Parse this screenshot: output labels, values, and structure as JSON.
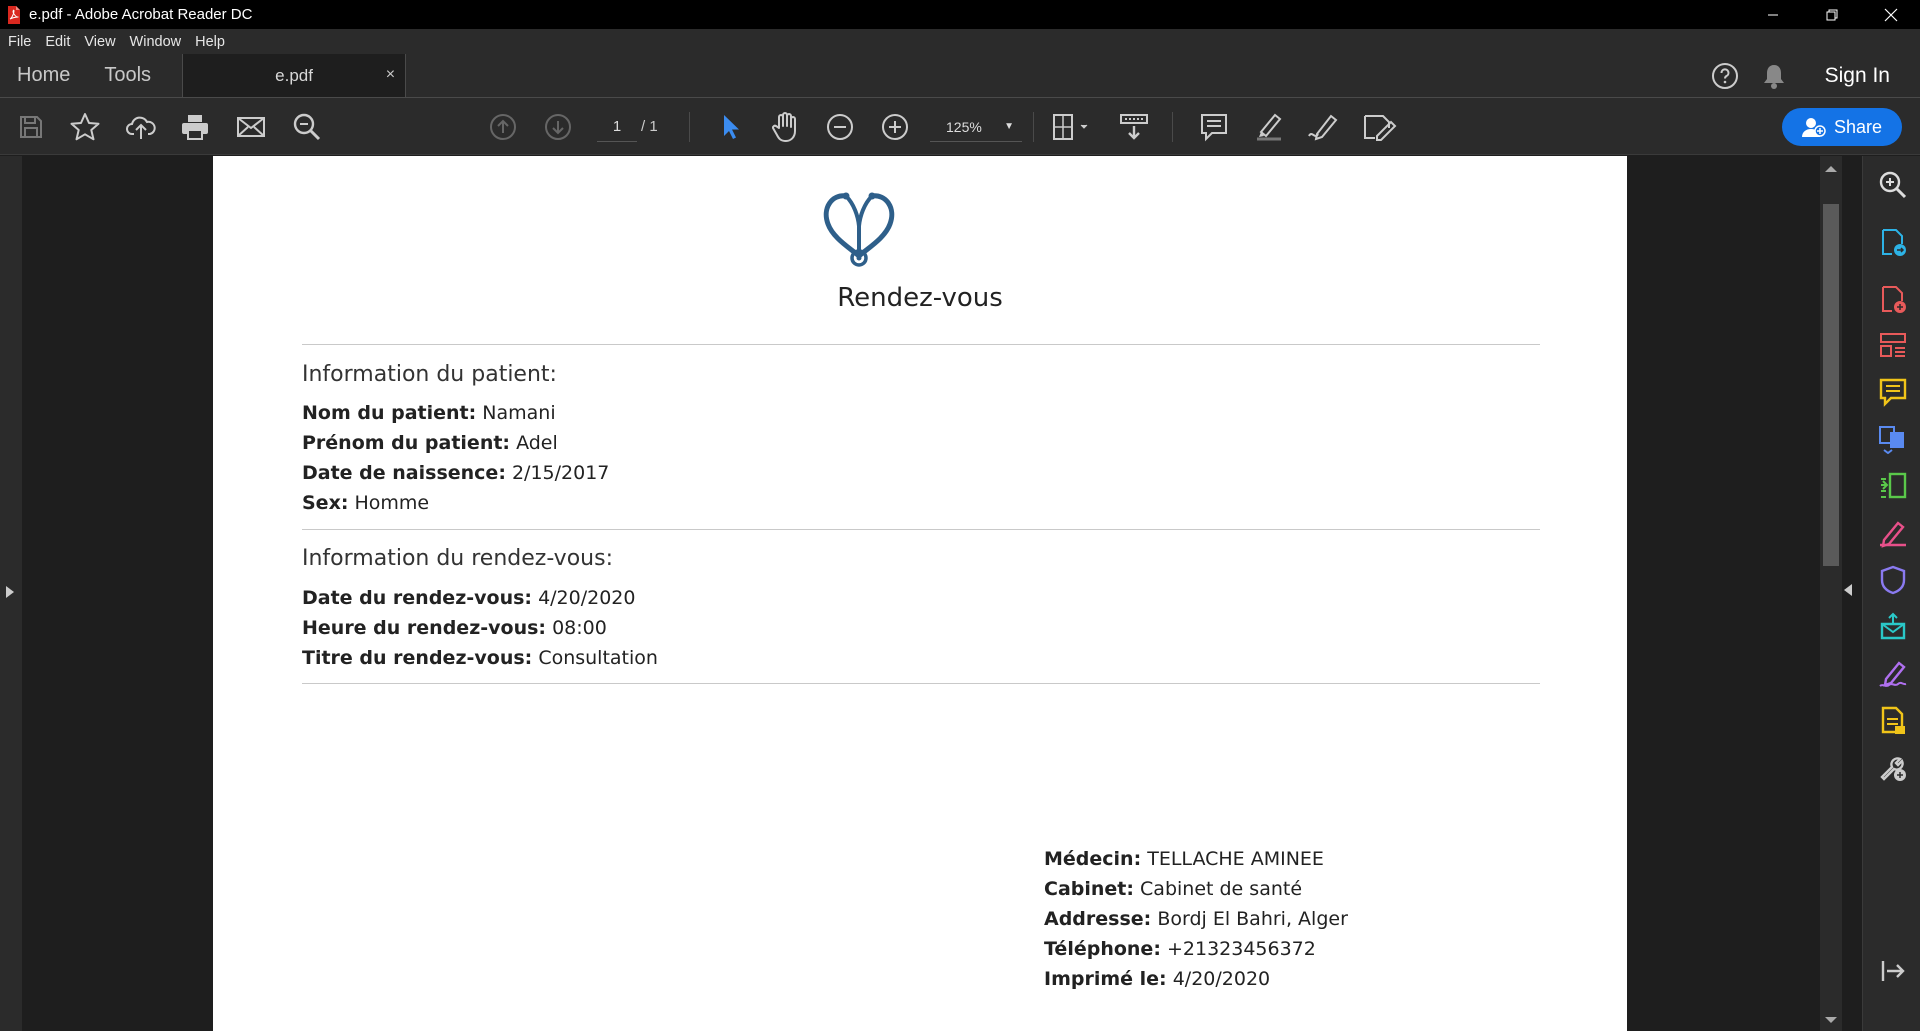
{
  "window": {
    "title": "e.pdf - Adobe Acrobat Reader DC"
  },
  "menu": [
    "File",
    "Edit",
    "View",
    "Window",
    "Help"
  ],
  "tabs": {
    "home": "Home",
    "tools": "Tools",
    "document": "e.pdf",
    "close_glyph": "×"
  },
  "header": {
    "sign_in": "Sign In",
    "share": "Share"
  },
  "toolbar": {
    "page_current": "1",
    "page_total": "/ 1",
    "zoom": "125%"
  },
  "document": {
    "title": "Rendez-vous",
    "patient_section": {
      "heading": "Information du patient:",
      "fields": [
        {
          "label": "Nom du patient:",
          "value": "Namani"
        },
        {
          "label": "Prénom du patient:",
          "value": "Adel"
        },
        {
          "label": "Date de naissence:",
          "value": "2/15/2017"
        },
        {
          "label": "Sex:",
          "value": "Homme"
        }
      ]
    },
    "appointment_section": {
      "heading": "Information du rendez-vous:",
      "fields": [
        {
          "label": "Date du rendez-vous:",
          "value": "4/20/2020"
        },
        {
          "label": "Heure du rendez-vous:",
          "value": "08:00"
        },
        {
          "label": "Titre du rendez-vous:",
          "value": "Consultation"
        }
      ]
    },
    "footer_fields": [
      {
        "label": "Médecin:",
        "value": "TELLACHE AMINEE"
      },
      {
        "label": "Cabinet:",
        "value": "Cabinet de santé"
      },
      {
        "label": "Addresse:",
        "value": "Bordj El Bahri, Alger"
      },
      {
        "label": "Téléphone:",
        "value": "+21323456372"
      },
      {
        "label": "Imprimé le:",
        "value": "4/20/2020"
      }
    ]
  },
  "icons": {
    "toolbar": [
      "save-icon",
      "star-icon",
      "upload-cloud-icon",
      "print-icon",
      "email-icon",
      "zoom-search-icon",
      "page-up-icon",
      "page-down-icon",
      "select-cursor-icon",
      "hand-icon",
      "zoom-out-icon",
      "zoom-in-icon",
      "page-fit-icon",
      "scroll-mode-icon",
      "comment-icon",
      "highlight-pen-icon",
      "draw-sign-icon",
      "fill-sign-icon"
    ],
    "right_panel": [
      "zoom-search-icon",
      "export-pdf-icon",
      "create-pdf-icon",
      "organize-pages-icon",
      "comment-icon",
      "combine-files-icon",
      "compress-icon",
      "fill-sign-icon",
      "protect-shield-icon",
      "send-review-icon",
      "request-signature-icon",
      "scan-icon",
      "more-tools-icon",
      "collapse-panel-icon"
    ]
  },
  "colors": {
    "accent": "#1473e6",
    "logo": "#2e5f8a",
    "right_panel_icons": [
      "#dddddd",
      "#2db3e6",
      "#e85a5a",
      "#e85a5a",
      "#f0c419",
      "#5a8af0",
      "#5ac84a",
      "#e8508a",
      "#8a7af0",
      "#2ac8c8",
      "#b070f0",
      "#f0c419",
      "#cccccc"
    ]
  }
}
